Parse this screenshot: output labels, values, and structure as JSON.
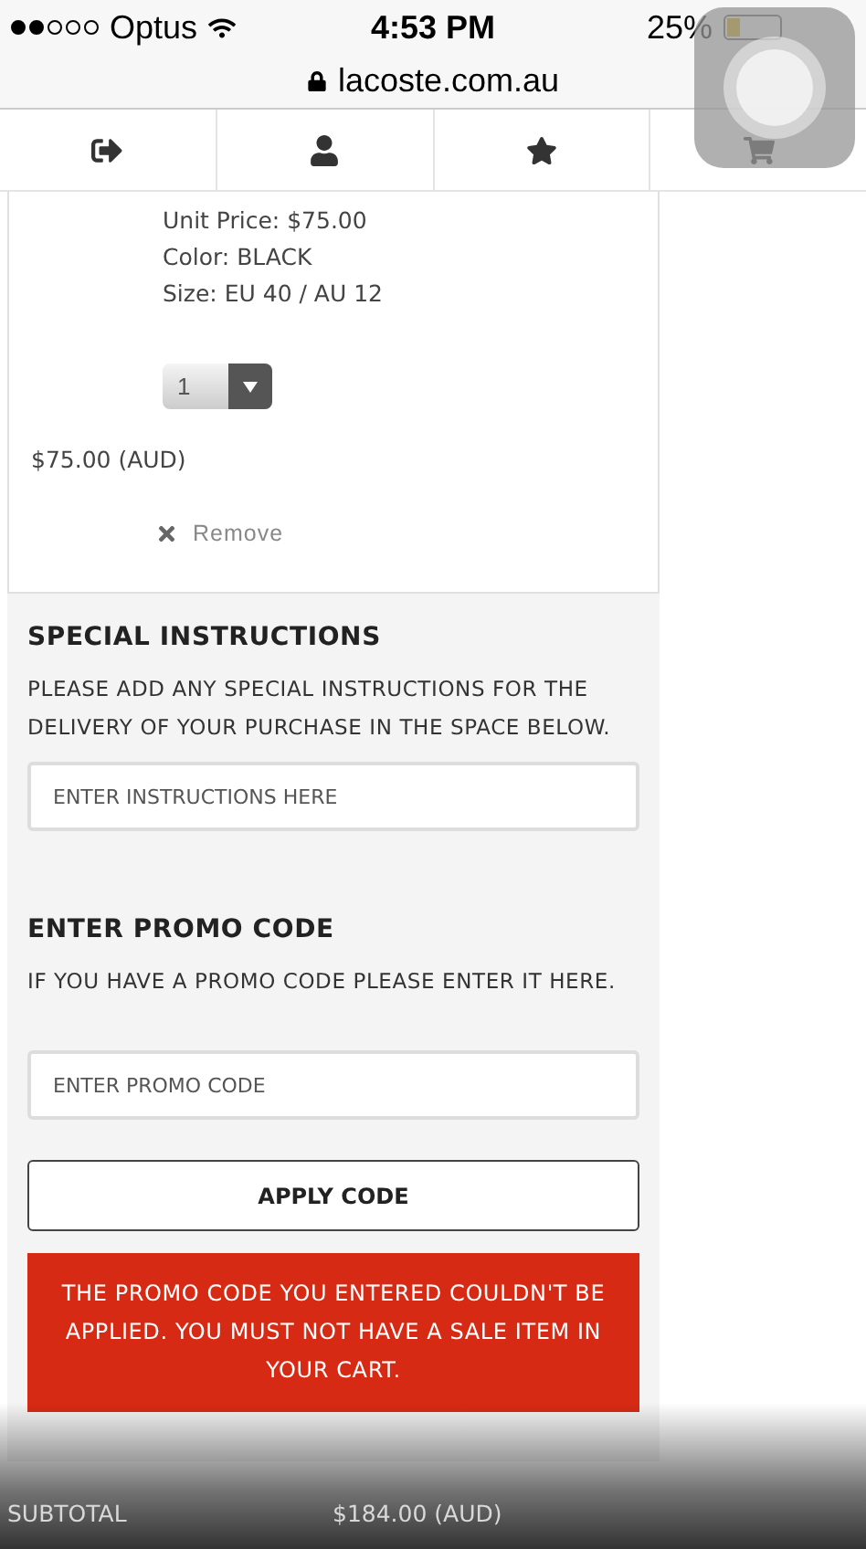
{
  "status_bar": {
    "carrier": "Optus",
    "time": "4:53 PM",
    "battery": "25%"
  },
  "address_bar": {
    "url": "lacoste.com.au"
  },
  "cart_item": {
    "details": [
      "Unit Price: $75.00",
      "Color: BLACK",
      "Size: EU 40 / AU 12"
    ],
    "quantity": "1",
    "line_total": "$75.00 (AUD)",
    "remove": "Remove"
  },
  "special_instructions": {
    "heading": "SPECIAL INSTRUCTIONS",
    "text": "PLEASE ADD ANY SPECIAL INSTRUCTIONS FOR THE DELIVERY OF YOUR PURCHASE IN THE SPACE BELOW.",
    "placeholder": "ENTER INSTRUCTIONS HERE"
  },
  "promo_code": {
    "heading": "ENTER PROMO CODE",
    "text": "IF YOU HAVE A PROMO CODE PLEASE ENTER IT HERE.",
    "placeholder": "ENTER PROMO CODE",
    "button": "APPLY CODE",
    "error": "THE PROMO CODE YOU ENTERED COULDN'T BE APPLIED. YOU MUST NOT HAVE A SALE ITEM IN YOUR CART."
  },
  "summary": {
    "label": "SUBTOTAL",
    "value": "$184.00 (AUD)"
  }
}
